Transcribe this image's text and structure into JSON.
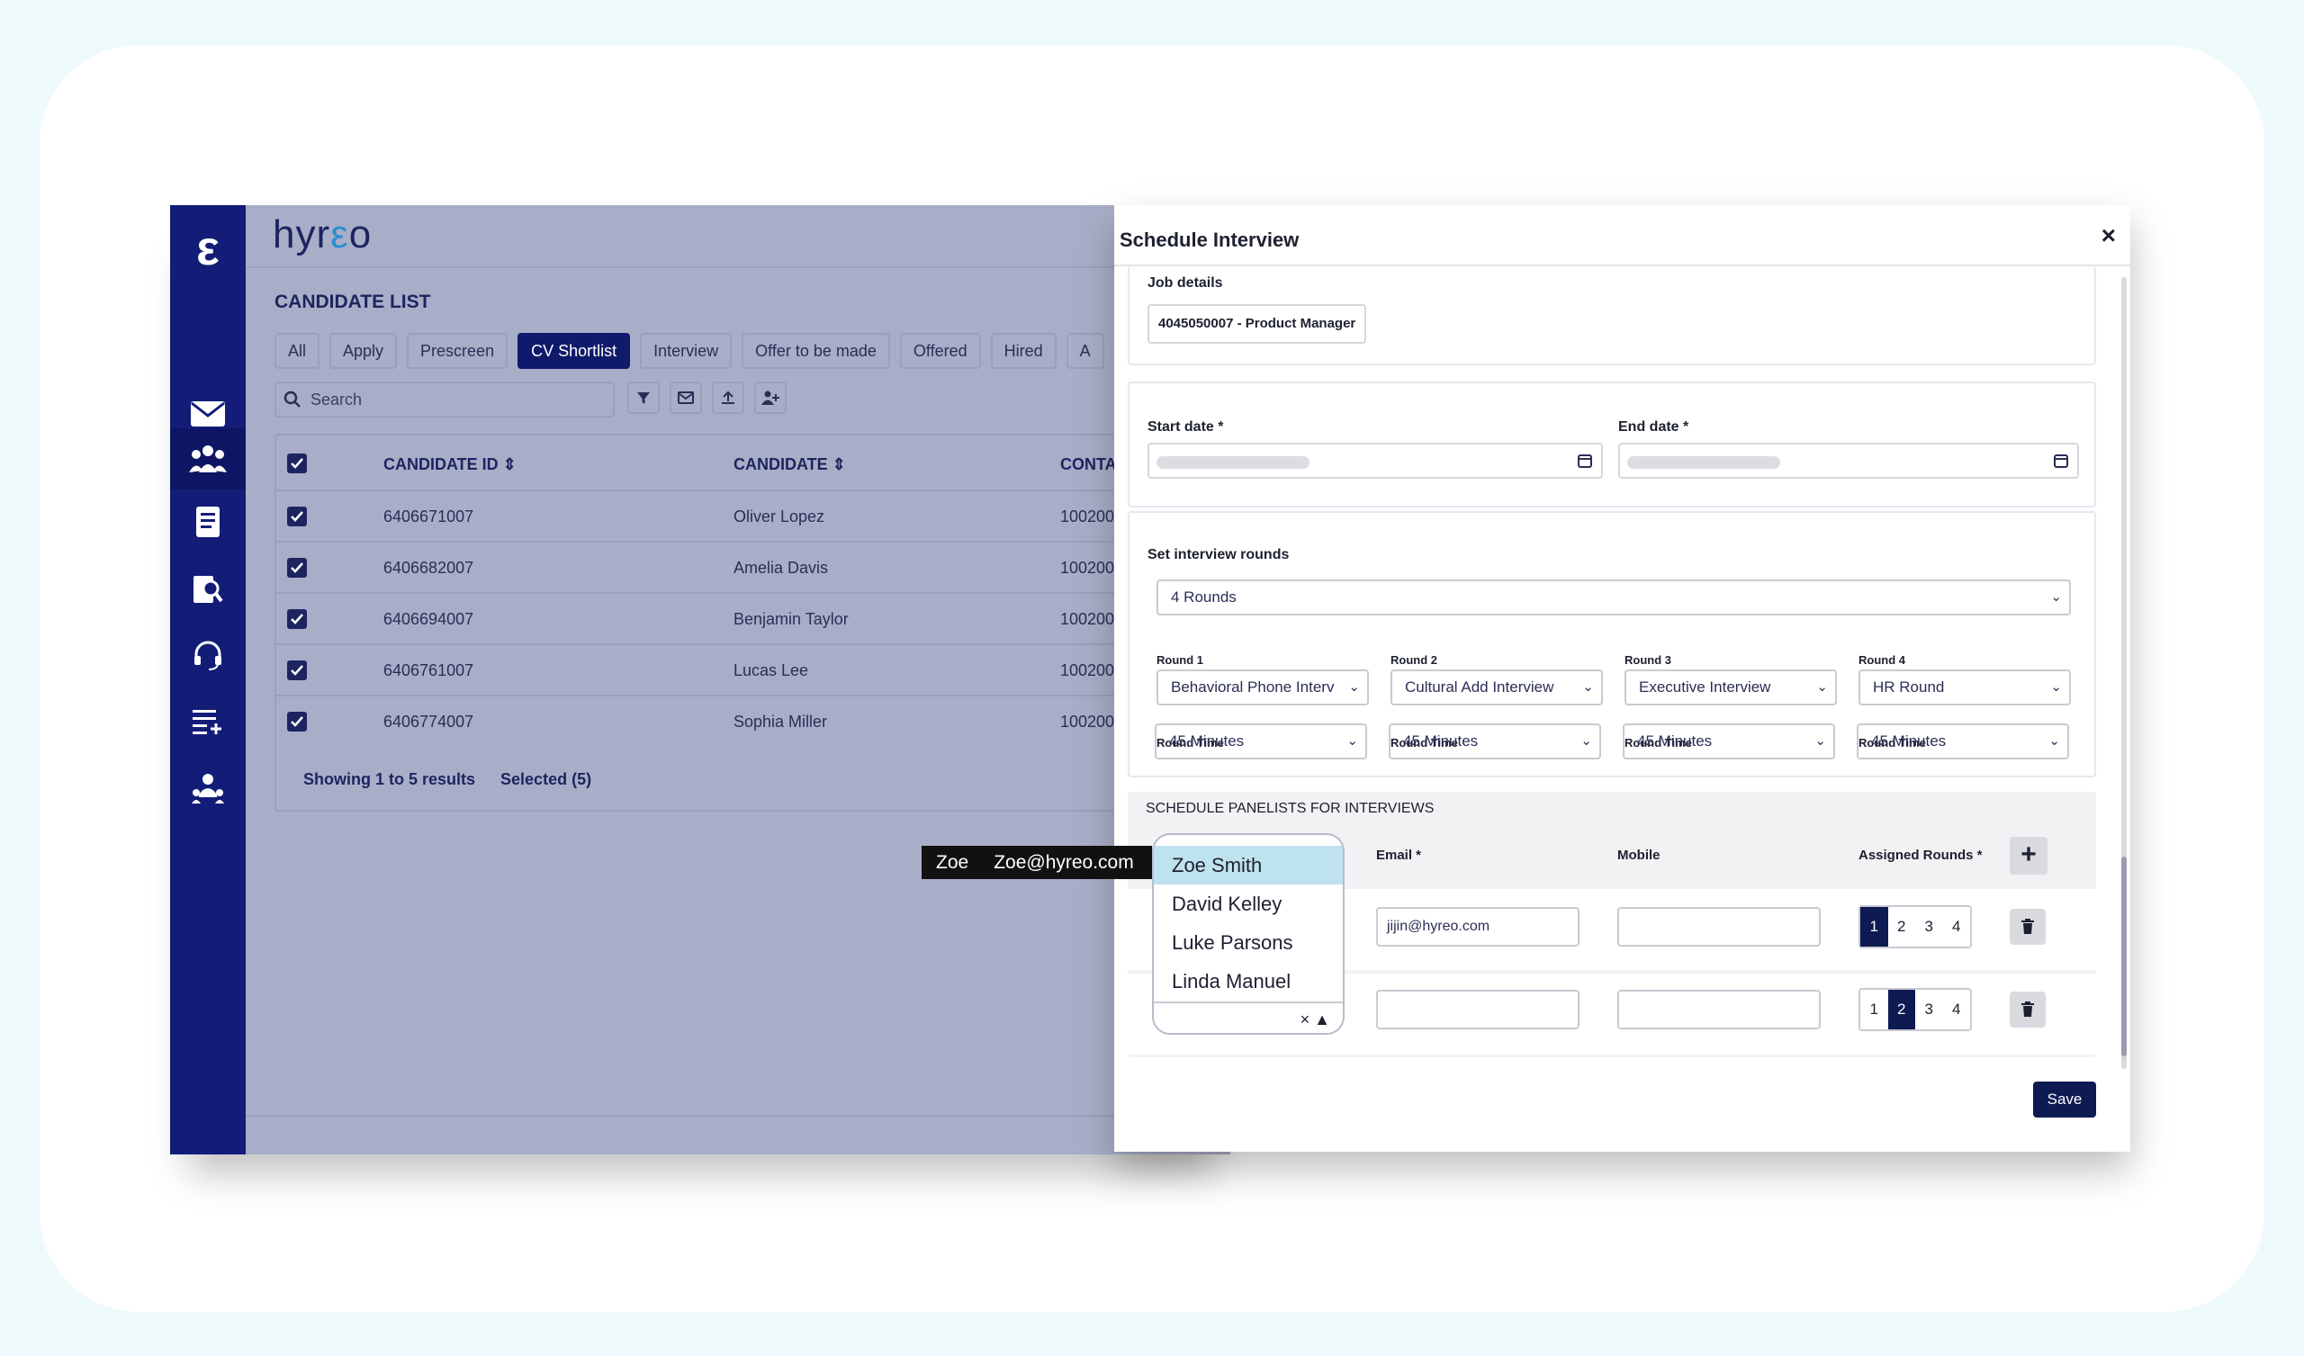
{
  "app": {
    "brand_prefix": "hyr",
    "brand_accent": "ε",
    "brand_suffix": "o",
    "logo_glyph": "ε"
  },
  "sidebar": {
    "icons": [
      "mail-icon",
      "candidates-icon",
      "report-icon",
      "search-doc-icon",
      "support-icon",
      "list-add-icon",
      "team-icon"
    ],
    "active": "candidates-icon"
  },
  "list": {
    "title": "CANDIDATE LIST",
    "tabs": [
      "All",
      "Apply",
      "Prescreen",
      "CV Shortlist",
      "Interview",
      "Offer to be made",
      "Offered",
      "Hired",
      "A"
    ],
    "active_tab": "CV Shortlist",
    "search_placeholder": "Search",
    "columns": [
      "CANDIDATE ID",
      "CANDIDATE",
      "CONTA"
    ],
    "rows": [
      {
        "id": "6406671007",
        "name": "Oliver Lopez",
        "contact": "100200"
      },
      {
        "id": "6406682007",
        "name": "Amelia Davis",
        "contact": "100200"
      },
      {
        "id": "6406694007",
        "name": "Benjamin Taylor",
        "contact": "100200"
      },
      {
        "id": "6406761007",
        "name": "Lucas Lee",
        "contact": "100200"
      },
      {
        "id": "6406774007",
        "name": "Sophia Miller",
        "contact": "100200"
      }
    ],
    "showing": "Showing 1 to 5 results",
    "selected": "Selected (5)"
  },
  "modal": {
    "title": "Schedule Interview",
    "close": "×",
    "job_label": "Job details",
    "job_value": "4045050007 - Product Manager",
    "start_label": "Start date *",
    "end_label": "End date *",
    "rounds_label": "Set interview rounds",
    "rounds_value": "4 Rounds",
    "rounds": [
      {
        "label": "Round 1",
        "value": "Behavioral Phone Interv",
        "time_label": "Round Time",
        "time": "45 Minutes"
      },
      {
        "label": "Round 2",
        "value": "Cultural Add Interview",
        "time_label": "Round Time",
        "time": "45 Minutes"
      },
      {
        "label": "Round 3",
        "value": "Executive Interview",
        "time_label": "Round Time",
        "time": "45 Minutes"
      },
      {
        "label": "Round 4",
        "value": "HR Round",
        "time_label": "Round Time",
        "time": "45 Minutes"
      }
    ],
    "panel_title": "SCHEDULE PANELISTS FOR INTERVIEWS",
    "panel_cols": {
      "email": "Email *",
      "mobile": "Mobile",
      "assigned": "Assigned Rounds *"
    },
    "panelists": [
      {
        "email": "jijin@hyreo.com",
        "mobile": "",
        "rounds": [
          "1",
          "2",
          "3",
          "4"
        ],
        "active_round": "1"
      },
      {
        "email": "",
        "mobile": "",
        "rounds": [
          "1",
          "2",
          "3",
          "4"
        ],
        "active_round": "2"
      }
    ],
    "save": "Save"
  },
  "tooltip": {
    "name": "Zoe",
    "email": "Zoe@hyreo.com"
  },
  "dropdown": {
    "options": [
      "Zoe Smith",
      "David Kelley",
      "Luke Parsons",
      "Linda Manuel"
    ],
    "highlighted": "Zoe Smith",
    "controls": "× ▲"
  },
  "colors": {
    "navy": "#131d78",
    "accent": "#0e1a52",
    "overlay": "#a9aec8",
    "highlight": "#bfe3ee"
  }
}
